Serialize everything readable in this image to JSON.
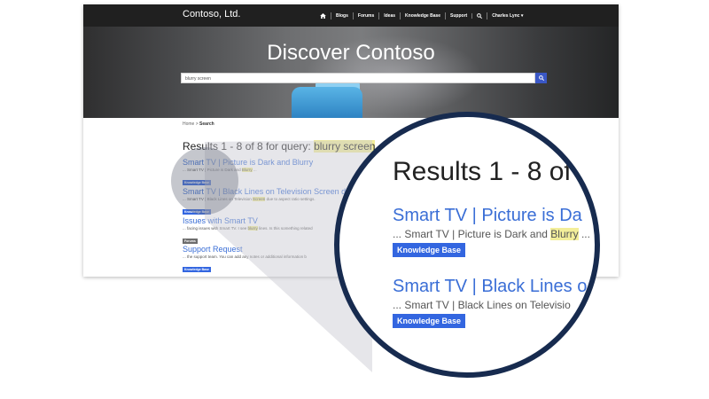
{
  "brand": "Contoso, Ltd.",
  "nav": {
    "items": [
      "Blogs",
      "Forums",
      "Ideas",
      "Knowledge Base",
      "Support"
    ],
    "user": "Charles Lync ▾"
  },
  "hero": {
    "title": "Discover Contoso",
    "search_value": "blurry screen"
  },
  "breadcrumb": {
    "home": "Home",
    "separator": ">",
    "current": "Search"
  },
  "results": {
    "prefix": "Results 1 - 8 of 8 for query: ",
    "query": "blurry screen",
    "items": [
      {
        "title": "Smart TV | Picture is Dark and Blurry",
        "snippet_pre": "... Smart TV | Picture is Dark and ",
        "snippet_hl": "Blurry",
        "snippet_post": " ...",
        "badge": "Knowledge Base"
      },
      {
        "title": "Smart TV | Black Lines on Television Screen du",
        "snippet_pre": "... Smart TV | Black Lines on Television ",
        "snippet_hl": "Screen",
        "snippet_post": " due to aspect ratio settings.",
        "badge": "Knowledge Base"
      },
      {
        "title": "Issues with Smart TV",
        "snippet_pre": "... facing issues with Smart TV. I see ",
        "snippet_hl": "blurry",
        "snippet_post": " lines. Is this something related",
        "badge": "Forums"
      },
      {
        "title": "Support Request",
        "snippet_pre": "... the support team. You can add any notes or additional information b",
        "snippet_hl": "",
        "snippet_post": "",
        "badge": "Knowledge Base"
      }
    ]
  },
  "zoom": {
    "heading": "Results 1 - 8 of",
    "items": [
      {
        "title": "Smart TV | Picture is Da",
        "snippet_pre": "... Smart TV | Picture is Dark and ",
        "snippet_hl": "Blurry",
        "snippet_post": " ...",
        "badge": "Knowledge Base"
      },
      {
        "title": "Smart TV | Black Lines o",
        "snippet_pre": "... Smart TV | Black Lines on Televisio",
        "snippet_hl": "",
        "snippet_post": "",
        "badge": "Knowledge Base"
      }
    ]
  },
  "colors": {
    "accent": "#3366e0",
    "link": "#3a6ed6",
    "highlight": "#f3ee9a",
    "zoom_ring": "#172b4f",
    "navbar": "#202020"
  }
}
